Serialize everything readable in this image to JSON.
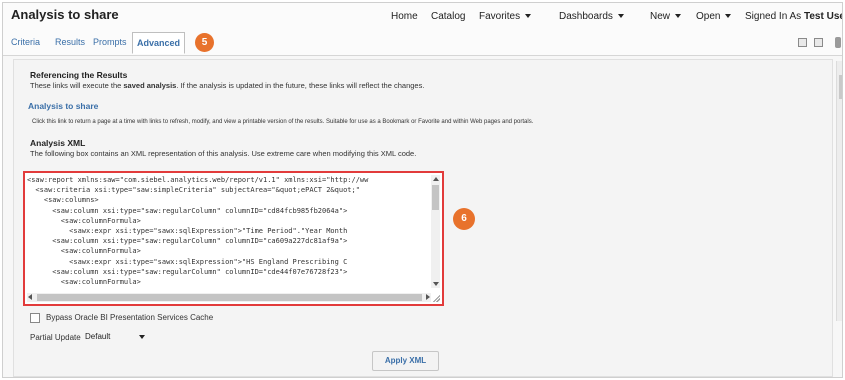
{
  "header": {
    "title": "Analysis to share",
    "nav": [
      {
        "label": "Home",
        "has_caret": false
      },
      {
        "label": "Catalog",
        "has_caret": false
      },
      {
        "label": "Favorites",
        "has_caret": true
      },
      {
        "label": "Dashboards",
        "has_caret": true
      },
      {
        "label": "New",
        "has_caret": true
      },
      {
        "label": "Open",
        "has_caret": true
      }
    ],
    "signed_in_label": "Signed In As",
    "user_name": "Test User"
  },
  "tabs": [
    "Criteria",
    "Results",
    "Prompts",
    "Advanced"
  ],
  "active_tab": "Advanced",
  "callouts": {
    "tab_marker": "5",
    "xml_marker": "6"
  },
  "toolbar_icons": [
    "save-icon",
    "save-as-icon",
    "more-icon"
  ],
  "referencing": {
    "heading": "Referencing the Results",
    "text_before": "These links will execute the ",
    "text_bold": "saved analysis",
    "text_after": ". If the analysis is updated in the future, these links will reflect the changes.",
    "link_label": "Analysis to share",
    "link_description": "Click this link to return a page at a time with links to refresh, modify, and view a printable version of the results. Suitable for use as a Bookmark or Favorite and within Web pages and portals."
  },
  "xml_section": {
    "heading": "Analysis XML",
    "description": "The following box contains an XML representation of this analysis. Use extreme care when modifying this XML code.",
    "lines": [
      "<saw:report xmlns:saw=\"com.siebel.analytics.web/report/v1.1\" xmlns:xsi=\"http://ww",
      "  <saw:criteria xsi:type=\"saw:simpleCriteria\" subjectArea=\"&quot;ePACT 2&quot;\"",
      "    <saw:columns>",
      "      <saw:column xsi:type=\"saw:regularColumn\" columnID=\"cd84fcb985fb2064a\">",
      "        <saw:columnFormula>",
      "          <sawx:expr xsi:type=\"sawx:sqlExpression\">\"Time Period\".\"Year Month",
      "      <saw:column xsi:type=\"saw:regularColumn\" columnID=\"ca609a227dc81af9a\">",
      "        <saw:columnFormula>",
      "          <sawx:expr xsi:type=\"sawx:sqlExpression\">\"HS England Prescribing C",
      "      <saw:column xsi:type=\"saw:regularColumn\" columnID=\"cde44f07e76728f23\">",
      "        <saw:columnFormula>",
      "          <sawx:expr xsi:type=\"sawx:sqlExpression\">\"Drug / Appliance\".\"BNF C"
    ]
  },
  "options": {
    "bypass_cache_label": "Bypass Oracle BI Presentation Services Cache",
    "bypass_cache_checked": false,
    "partial_update_label": "Partial Update",
    "partial_update_value": "Default"
  },
  "apply_button_label": "Apply XML",
  "colors": {
    "accent": "#3a6fa8",
    "callout": "#e8722c",
    "highlight": "#e23b3b"
  }
}
